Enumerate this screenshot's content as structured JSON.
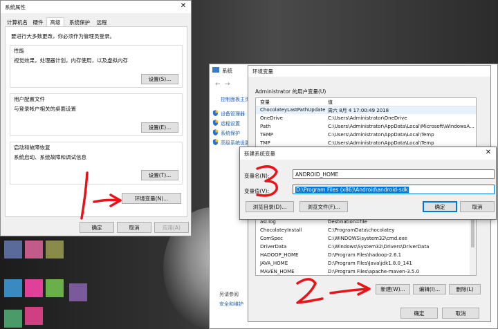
{
  "sysprops": {
    "title": "系统属性",
    "tabs": [
      "计算机名",
      "硬件",
      "高级",
      "系统保护",
      "远程"
    ],
    "admin_note": "要进行大多数更改，你必须作为管理员登录。",
    "performance": {
      "title": "性能",
      "desc": "视觉效果，处理器计划，内存使用，以及虚拟内存",
      "button": "设置(S)..."
    },
    "profiles": {
      "title": "用户配置文件",
      "desc": "与登录帐户相关的桌面设置",
      "button": "设置(E)..."
    },
    "startup": {
      "title": "启动和故障恢复",
      "desc": "系统启动、系统故障和调试信息",
      "button": "设置(T)..."
    },
    "env_button": "环境变量(N)...",
    "ok": "确定",
    "cancel": "取消",
    "apply": "应用(A)"
  },
  "system_window": {
    "title": "系统",
    "control_panel_home": "控制面板主页",
    "links": [
      "设备管理器",
      "远程设置",
      "系统保护",
      "高级系统设置"
    ],
    "see_also": "另请参阅",
    "security": "安全和维护"
  },
  "envvars": {
    "title": "环境变量",
    "user_section": "Administrator 的用户变量(U)",
    "col_var": "变量",
    "col_val": "值",
    "user_vars": [
      {
        "name": "ChocolateyLastPathUpdate",
        "value": "周六 8月  4 17:00:49 2018"
      },
      {
        "name": "OneDrive",
        "value": "C:\\Users\\Administrator\\OneDrive"
      },
      {
        "name": "Path",
        "value": "C:\\Users\\Administrator\\AppData\\Local\\Microsoft\\WindowsA..."
      },
      {
        "name": "TEMP",
        "value": "C:\\Users\\Administrator\\AppData\\Local\\Temp"
      },
      {
        "name": "TMP",
        "value": "C:\\Users\\Administrator\\AppData\\Local\\Temp"
      }
    ],
    "system_vars": [
      {
        "name": "asl.log",
        "value": "Destination=file"
      },
      {
        "name": "ChocolateyInstall",
        "value": "C:\\ProgramData\\chocolatey"
      },
      {
        "name": "ComSpec",
        "value": "C:\\WINDOWS\\system32\\cmd.exe"
      },
      {
        "name": "DriverData",
        "value": "C:\\Windows\\System32\\Drivers\\DriverData"
      },
      {
        "name": "HADOOP_HOME",
        "value": "D:\\Program Files\\hadoop-2.6.1"
      },
      {
        "name": "JAVA_HOME",
        "value": "D:\\Program Files\\Java\\jdk1.8.0_141"
      },
      {
        "name": "MAVEN_HOME",
        "value": "D:\\Program Files\\apache-maven-3.5.0"
      }
    ],
    "new_button": "新建(W)...",
    "edit_button": "编辑(I)...",
    "delete_button": "删除(L)",
    "ok": "确定",
    "cancel": "取消"
  },
  "newvar": {
    "title": "新建系统变量",
    "name_label": "变量名(N):",
    "name_value": "ANDROID_HOME",
    "value_label": "变量值(V):",
    "value_value": "D:\\Program Files (x86)\\Android\\android-sdk",
    "browse_dir": "浏览目录(D)...",
    "browse_file": "浏览文件(F)...",
    "ok": "确定",
    "cancel": "取消"
  },
  "annotations": {
    "step1": "1",
    "step2": "2",
    "step3": "3",
    "color": "#e8141a"
  },
  "colors": {
    "selection": "#0078d7",
    "selected_row": "#cce8ff"
  },
  "icons": {
    "close": "close-icon",
    "shield": "shield-icon"
  }
}
